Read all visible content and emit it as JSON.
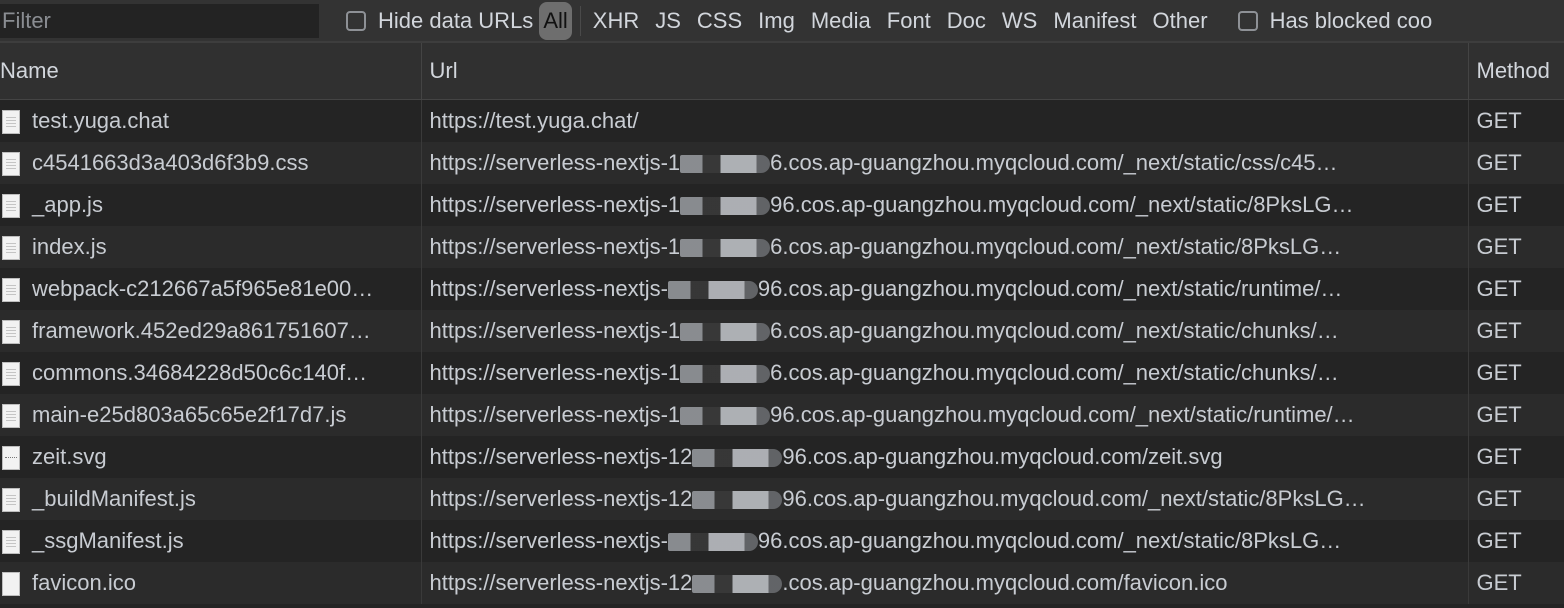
{
  "toolbar": {
    "filter_placeholder": "Filter",
    "hide_data_urls_label": "Hide data URLs",
    "hide_data_urls_checked": false,
    "type_filters": [
      "All",
      "XHR",
      "JS",
      "CSS",
      "Img",
      "Media",
      "Font",
      "Doc",
      "WS",
      "Manifest",
      "Other"
    ],
    "active_type_filter": "All",
    "has_blocked_cookies_label": "Has blocked coo",
    "has_blocked_cookies_checked": false
  },
  "table": {
    "columns": [
      "Name",
      "Url",
      "Method"
    ],
    "rows": [
      {
        "icon": "document-icon",
        "name": "test.yuga.chat",
        "url_prefix": "https://test.yuga.chat/",
        "redacted": false,
        "url_suffix": "",
        "method": "GET"
      },
      {
        "icon": "document-icon",
        "name": "c4541663d3a403d6f3b9.css",
        "url_prefix": "https://serverless-nextjs-1",
        "redacted": true,
        "url_suffix": "6.cos.ap-guangzhou.myqcloud.com/_next/static/css/c45…",
        "method": "GET"
      },
      {
        "icon": "document-icon",
        "name": "_app.js",
        "url_prefix": "https://serverless-nextjs-1",
        "redacted": true,
        "url_suffix": "96.cos.ap-guangzhou.myqcloud.com/_next/static/8PksLG…",
        "method": "GET"
      },
      {
        "icon": "document-icon",
        "name": "index.js",
        "url_prefix": "https://serverless-nextjs-1",
        "redacted": true,
        "url_suffix": "6.cos.ap-guangzhou.myqcloud.com/_next/static/8PksLG…",
        "method": "GET"
      },
      {
        "icon": "document-icon",
        "name": "webpack-c212667a5f965e81e00…",
        "url_prefix": "https://serverless-nextjs-",
        "redacted": true,
        "url_suffix": "96.cos.ap-guangzhou.myqcloud.com/_next/static/runtime/…",
        "method": "GET"
      },
      {
        "icon": "document-icon",
        "name": "framework.452ed29a861751607…",
        "url_prefix": "https://serverless-nextjs-1",
        "redacted": true,
        "url_suffix": "6.cos.ap-guangzhou.myqcloud.com/_next/static/chunks/…",
        "method": "GET"
      },
      {
        "icon": "document-icon",
        "name": "commons.34684228d50c6c140f…",
        "url_prefix": "https://serverless-nextjs-1",
        "redacted": true,
        "url_suffix": "6.cos.ap-guangzhou.myqcloud.com/_next/static/chunks/…",
        "method": "GET"
      },
      {
        "icon": "document-icon",
        "name": "main-e25d803a65c65e2f17d7.js",
        "url_prefix": "https://serverless-nextjs-1",
        "redacted": true,
        "url_suffix": "96.cos.ap-guangzhou.myqcloud.com/_next/static/runtime/…",
        "method": "GET"
      },
      {
        "icon": "image-icon",
        "name": "zeit.svg",
        "url_prefix": "https://serverless-nextjs-12",
        "redacted": true,
        "url_suffix": "96.cos.ap-guangzhou.myqcloud.com/zeit.svg",
        "method": "GET"
      },
      {
        "icon": "document-icon",
        "name": "_buildManifest.js",
        "url_prefix": "https://serverless-nextjs-12",
        "redacted": true,
        "url_suffix": "96.cos.ap-guangzhou.myqcloud.com/_next/static/8PksLG…",
        "method": "GET"
      },
      {
        "icon": "document-icon",
        "name": "_ssgManifest.js",
        "url_prefix": "https://serverless-nextjs-",
        "redacted": true,
        "url_suffix": "96.cos.ap-guangzhou.myqcloud.com/_next/static/8PksLG…",
        "method": "GET"
      },
      {
        "icon": "blank-icon",
        "name": "favicon.ico",
        "url_prefix": "https://serverless-nextjs-12",
        "redacted": true,
        "url_suffix": ".cos.ap-guangzhou.myqcloud.com/favicon.ico",
        "method": "GET"
      }
    ]
  }
}
